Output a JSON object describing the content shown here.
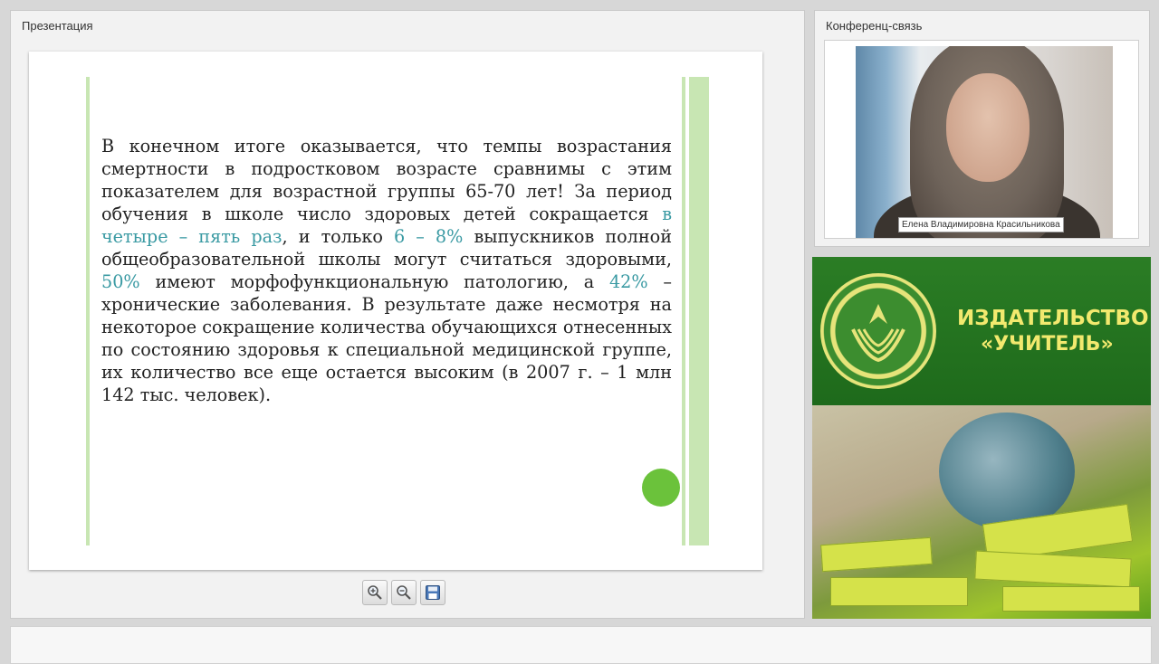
{
  "presentation_panel": {
    "title": "Презентация"
  },
  "slide": {
    "paragraph_parts": [
      {
        "text": "В конечном итоге оказывается, что темпы возрастания смертности в подростковом возрасте сравнимы с этим показателем для возрастной группы 65-70 лет! За период обучения в школе число здоровых детей сокращается ",
        "highlight": false
      },
      {
        "text": "в четыре – пять раз",
        "highlight": true
      },
      {
        "text": ", и только ",
        "highlight": false
      },
      {
        "text": "6 – 8%",
        "highlight": true
      },
      {
        "text": " выпускников полной общеобразовательной школы могут считаться здоровыми, ",
        "highlight": false
      },
      {
        "text": "50%",
        "highlight": true
      },
      {
        "text": " имеют морфофункциональную патологию, а ",
        "highlight": false
      },
      {
        "text": "42%",
        "highlight": true
      },
      {
        "text": " – хронические заболевания. В результате даже несмотря на некоторое сокращение количества обучающихся отнесенных по состоянию здоровья к специальной медицинской группе, их количество все еще остается высоким (в 2007 г. – 1 млн 142 тыс. человек).",
        "highlight": false
      }
    ],
    "colors": {
      "highlight": "#3a9aa3",
      "accent_bar": "#c8e6b3",
      "dot": "#6bc23b"
    }
  },
  "toolbar": {
    "buttons": [
      {
        "icon": "zoom-in-icon"
      },
      {
        "icon": "zoom-out-icon"
      },
      {
        "icon": "save-icon"
      }
    ]
  },
  "conference_panel": {
    "title": "Конференц-связь",
    "participant_name": "Елена Владимировна Красильникова"
  },
  "ad": {
    "line1": "ИЗДАТЕЛЬСТВО",
    "line2": "«УЧИТЕЛЬ»",
    "colors": {
      "background": "#1e6a1b",
      "text": "#f2e96e"
    }
  }
}
